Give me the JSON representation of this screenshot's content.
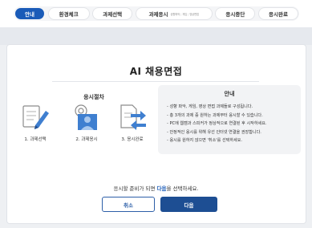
{
  "tabs": [
    {
      "label": "안내",
      "active": true
    },
    {
      "label": "환경체크"
    },
    {
      "label": "과제선택"
    },
    {
      "label": "과제응시",
      "sub": [
        "성향파악",
        "게임",
        "영상면접"
      ]
    },
    {
      "label": "응시중단"
    },
    {
      "label": "응시완료"
    }
  ],
  "main": {
    "title": "AI 채용면접",
    "process_title": "응시절차",
    "steps": [
      {
        "label": "1. 과제선택",
        "icon": "checklist-pencil-icon"
      },
      {
        "label": "2. 과제응시",
        "icon": "person-webcam-icon"
      },
      {
        "label": "3. 응시완료",
        "icon": "document-transfer-icon"
      }
    ],
    "info": {
      "title": "안내",
      "items": [
        "- 성향 파악, 게임, 영상 면접 과제들로 구성됩니다.",
        "- 총 3개의 과제 중 원하는 과제부터 응시할 수 있습니다.",
        "- PC에 웹캠과 스피커가 정상적으로 연결된 후 시작하세요.",
        "- 안정적인 응시를 위해 유선 인터넷 연결을 권장합니다.",
        "- 응시를 원하지 않으면 '취소'를 선택하세요."
      ]
    },
    "prompt": {
      "before": "응시할 준비가 되면 ",
      "highlight": "다음",
      "after": "을 선택하세요."
    },
    "cancel_label": "취소",
    "next_label": "다음"
  },
  "colors": {
    "accent": "#1a5bb8",
    "button_primary": "#1d4e93",
    "icon_blue": "#3f7fd0"
  }
}
